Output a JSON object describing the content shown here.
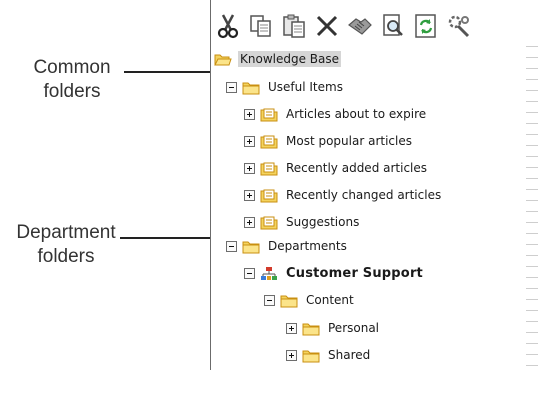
{
  "callouts": {
    "common": [
      "Common",
      "folders"
    ],
    "department": [
      "Department",
      "folders"
    ]
  },
  "toolbar": [
    {
      "name": "cut",
      "icon": "scissors-icon"
    },
    {
      "name": "copy",
      "icon": "copy-icon"
    },
    {
      "name": "paste",
      "icon": "paste-icon"
    },
    {
      "name": "delete",
      "icon": "delete-x-icon"
    },
    {
      "name": "permissions",
      "icon": "handshake-icon"
    },
    {
      "name": "view",
      "icon": "document-magnifier-icon"
    },
    {
      "name": "refresh",
      "icon": "refresh-icon"
    },
    {
      "name": "tools",
      "icon": "wrench-gear-icon"
    }
  ],
  "tree": {
    "root": {
      "label": "Knowledge Base",
      "icon": "folder-open-icon"
    },
    "useful_items": {
      "label": "Useful Items",
      "toggle": "minus"
    },
    "articles_expire": {
      "label": "Articles about to expire",
      "toggle": "plus"
    },
    "most_popular": {
      "label": "Most popular articles",
      "toggle": "plus"
    },
    "recently_added": {
      "label": "Recently added articles",
      "toggle": "plus"
    },
    "recently_changed": {
      "label": "Recently changed articles",
      "toggle": "plus"
    },
    "suggestions": {
      "label": "Suggestions",
      "toggle": "plus"
    },
    "departments": {
      "label": "Departments",
      "toggle": "minus"
    },
    "customer_support": {
      "label": "Customer Support",
      "toggle": "minus",
      "icon": "org-chart-icon"
    },
    "content": {
      "label": "Content",
      "toggle": "minus"
    },
    "personal": {
      "label": "Personal",
      "toggle": "plus"
    },
    "shared": {
      "label": "Shared",
      "toggle": "plus"
    }
  },
  "colors": {
    "folder_fill": "#f4d35e",
    "folder_stroke": "#c98f10",
    "selection": "#d6d6d6",
    "refresh_green": "#2f9e3f"
  }
}
